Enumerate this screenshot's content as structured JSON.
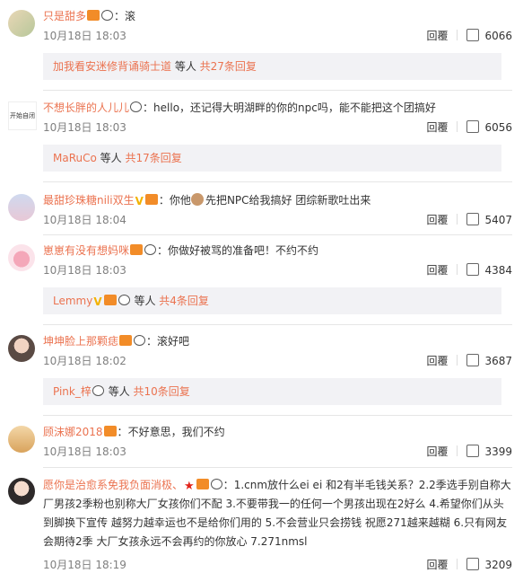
{
  "comments": [
    {
      "username": "只是甜多",
      "sep": "：",
      "text": "滚",
      "date": "10月18日 18:03",
      "reply": "回覆",
      "likes": "6066",
      "sub": {
        "names": "加我看安迷修背诵骑士道",
        "suffix": " 等人 ",
        "count": "共27条回复"
      }
    },
    {
      "username": "不想长胖的人儿儿",
      "sep": "：",
      "text": "hello，还记得大明湖畔的你的npc吗，能不能把这个团搞好",
      "avatar_text": "开始自闭",
      "date": "10月18日 18:03",
      "reply": "回覆",
      "likes": "6056",
      "sub": {
        "names": "MaRuCo",
        "suffix": " 等人 ",
        "count": "共17条回复"
      }
    },
    {
      "username": "最甜珍珠糖nili双生",
      "sep": "：",
      "text_a": "你他",
      "text_b": "先把NPC给我搞好 团综新歌吐出来",
      "date": "10月18日 18:04",
      "reply": "回覆",
      "likes": "5407"
    },
    {
      "username": "崽崽有没有想妈咪",
      "sep": "：",
      "text": "你做好被骂的准备吧！不约不约",
      "date": "10月18日 18:03",
      "reply": "回覆",
      "likes": "4384",
      "sub": {
        "names": "Lemmy",
        "suffix": " 等人 ",
        "count": "共4条回复"
      }
    },
    {
      "username": "坤坤脸上那颗痣",
      "sep": "：",
      "text": "滚好吧",
      "date": "10月18日 18:02",
      "reply": "回覆",
      "likes": "3687",
      "sub": {
        "names": "Pink_梓",
        "suffix": " 等人 ",
        "count": "共10条回复"
      }
    },
    {
      "username": "顾沫娜2018",
      "sep": "：",
      "text": "不好意思，我们不约",
      "date": "10月18日 18:03",
      "reply": "回覆",
      "likes": "3399"
    },
    {
      "username": "愿你是治愈系免我负面消极、",
      "sep": "：",
      "text": "1.cnm放什么ei ei 和2有半毛钱关系？2.2季选手别自称大厂男孩2季粉也别称大厂女孩你们不配 3.不要带我一的任何一个男孩出现在2好么 4.希望你们从头到脚换下宣传 越努力越幸运也不是给你们用的 5.不会营业只会捞钱 祝愿271越来越糊 6.只有网友会期待2季 大厂女孩永远不会再约的你放心 7.271nmsl",
      "date": "10月18日 18:19",
      "reply": "回覆",
      "likes": "3209"
    }
  ],
  "colors": {
    "username": "#eb7350",
    "meta": "#808080",
    "sub_bg": "#f2f2f5",
    "divider": "#e6e6e6"
  }
}
